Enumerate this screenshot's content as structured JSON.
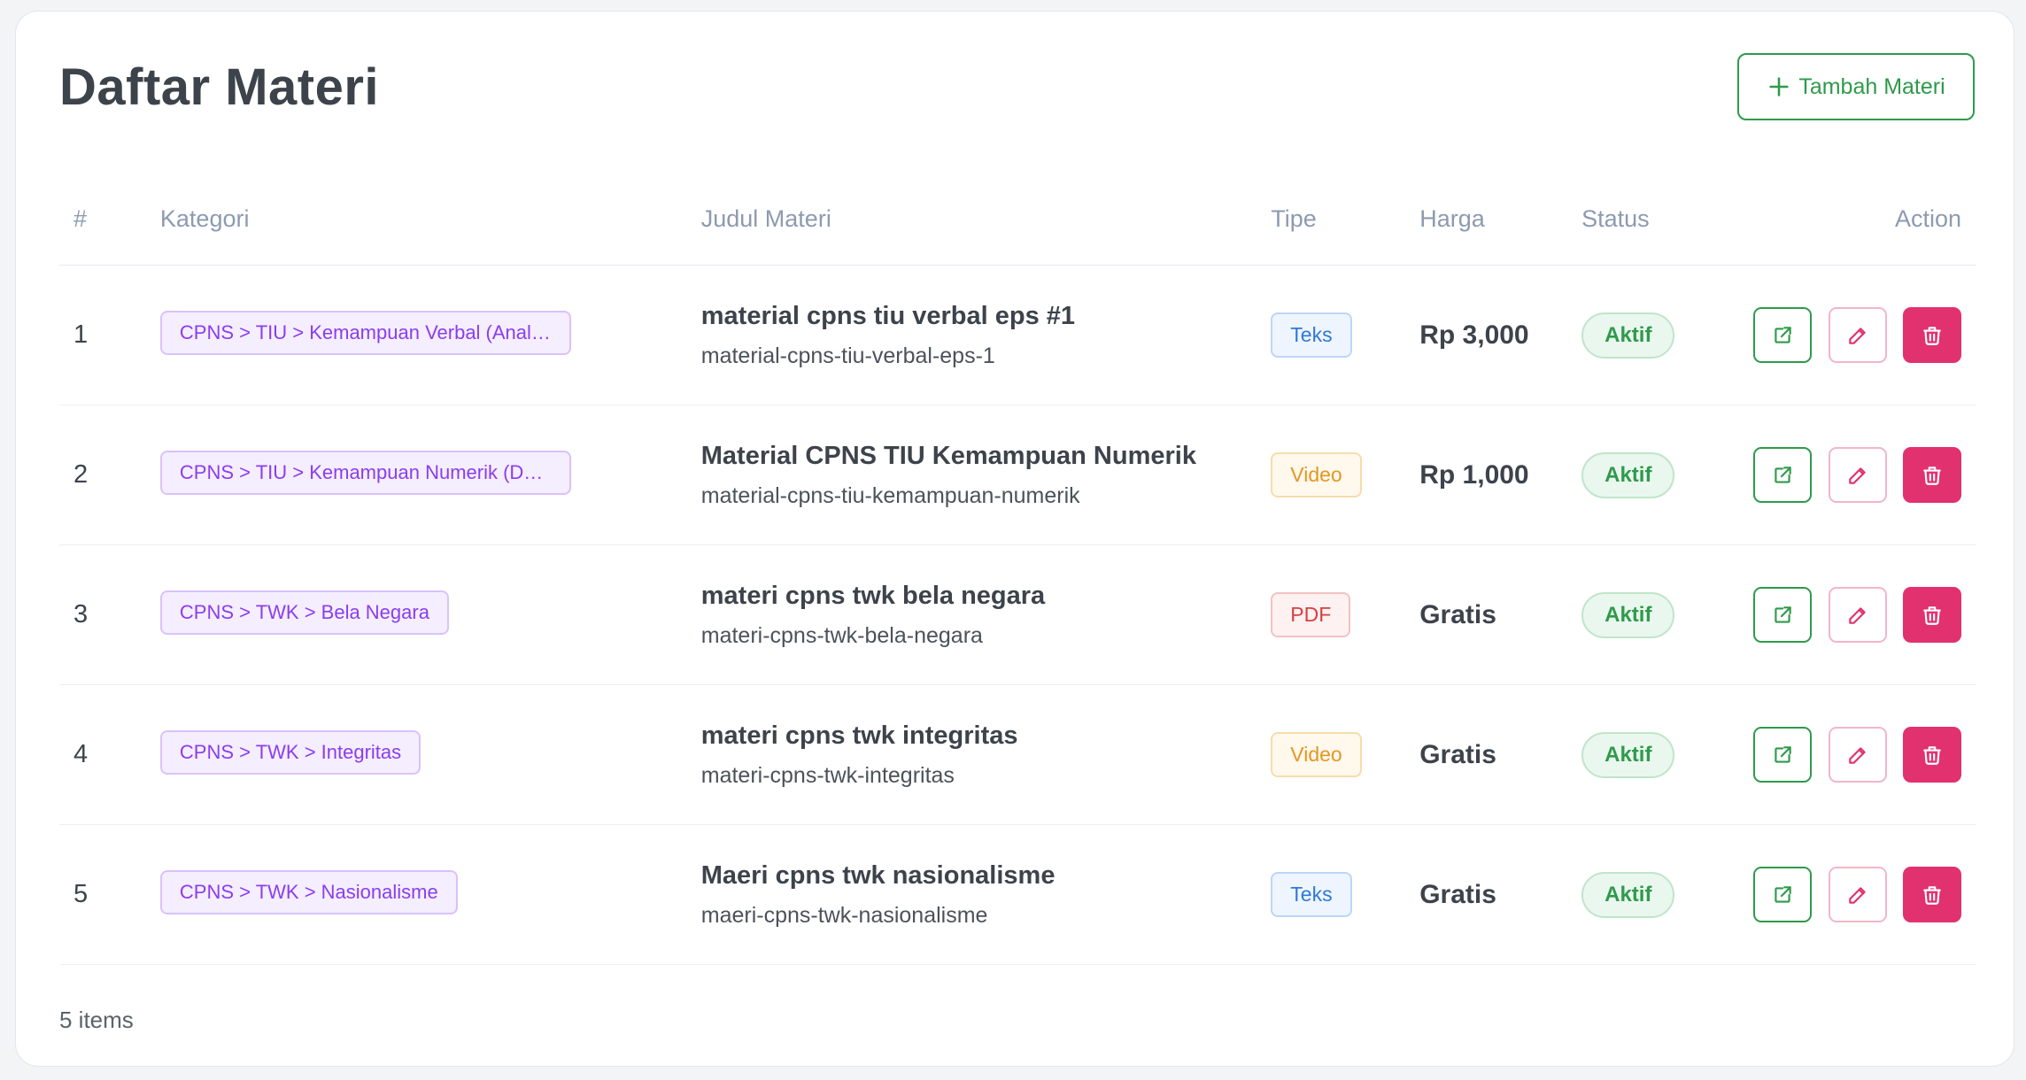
{
  "page": {
    "title": "Daftar Materi",
    "add_button_label": "Tambah Materi",
    "items_count": "5 items"
  },
  "table": {
    "headers": {
      "num": "#",
      "kategori": "Kategori",
      "judul": "Judul Materi",
      "tipe": "Tipe",
      "harga": "Harga",
      "status": "Status",
      "action": "Action"
    },
    "rows": [
      {
        "num": "1",
        "kategori": "CPNS > TIU > Kemampuan Verbal (Analogi…",
        "judul": "material cpns tiu verbal eps #1",
        "slug": "material-cpns-tiu-verbal-eps-1",
        "tipe": "Teks",
        "harga": "Rp 3,000",
        "status": "Aktif"
      },
      {
        "num": "2",
        "kategori": "CPNS > TIU > Kemampuan Numerik (Deret…",
        "judul": "Material CPNS TIU Kemampuan Numerik",
        "slug": "material-cpns-tiu-kemampuan-numerik",
        "tipe": "Video",
        "harga": "Rp 1,000",
        "status": "Aktif"
      },
      {
        "num": "3",
        "kategori": "CPNS > TWK > Bela Negara",
        "judul": "materi cpns twk bela negara",
        "slug": "materi-cpns-twk-bela-negara",
        "tipe": "PDF",
        "harga": "Gratis",
        "status": "Aktif"
      },
      {
        "num": "4",
        "kategori": "CPNS > TWK > Integritas",
        "judul": "materi cpns twk integritas",
        "slug": "materi-cpns-twk-integritas",
        "tipe": "Video",
        "harga": "Gratis",
        "status": "Aktif"
      },
      {
        "num": "5",
        "kategori": "CPNS > TWK > Nasionalisme",
        "judul": "Maeri cpns twk nasionalisme",
        "slug": "maeri-cpns-twk-nasionalisme",
        "tipe": "Teks",
        "harga": "Gratis",
        "status": "Aktif"
      }
    ]
  },
  "icons": {
    "add": "plus-icon",
    "view": "external-link-icon",
    "edit": "pencil-icon",
    "delete": "trash-icon"
  },
  "colors": {
    "primary_green": "#2e9a4b",
    "danger_pink": "#e2316f",
    "kategori_purple": "#8a3df0",
    "tipe_teks": "#2f78d8",
    "tipe_video": "#e49722",
    "tipe_pdf": "#d84040"
  }
}
